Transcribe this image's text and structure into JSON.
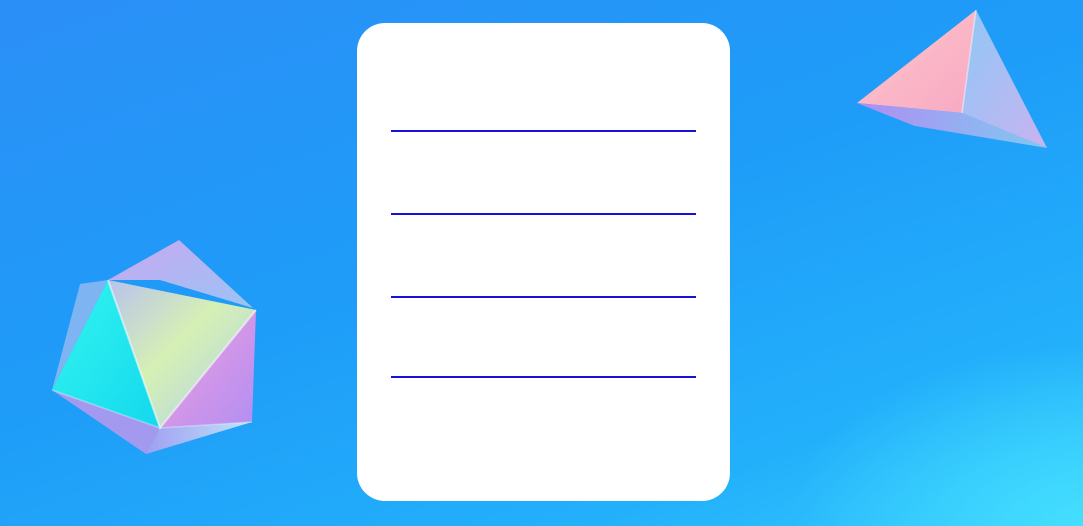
{
  "background": {
    "gradient_colors": [
      "#2b8ff7",
      "#1e9cf8",
      "#23b0fb",
      "#33c8fd"
    ]
  },
  "decorations": [
    {
      "name": "icosahedron-icon",
      "colors": [
        "#00f0ee",
        "#f0a0e0",
        "#b59cf5",
        "#e6f7a8"
      ]
    },
    {
      "name": "pyramid-icon",
      "colors": [
        "#ffb7c0",
        "#86c4f5",
        "#a98ff0"
      ]
    }
  ],
  "card": {
    "background": "#ffffff",
    "line_color": "#1a0fd6",
    "lines": [
      "",
      "",
      "",
      ""
    ]
  }
}
